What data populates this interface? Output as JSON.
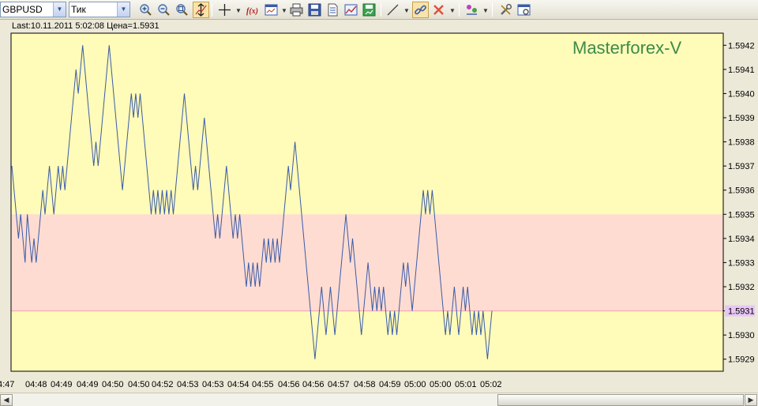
{
  "toolbar": {
    "symbol": "GBPUSD",
    "timeframe": "Тик",
    "fx_label": "f(x)"
  },
  "info_line": "Last:10.11.2011 5:02:08 Цена=1.5931",
  "watermark": "Masterforex-V",
  "chart_data": {
    "type": "line",
    "y_ticks": [
      "1.5942",
      "1.5941",
      "1.5940",
      "1.5939",
      "1.5938",
      "1.5937",
      "1.5936",
      "1.5935",
      "1.5934",
      "1.5933",
      "1.5932",
      "1.5931",
      "1.5930",
      "1.5929"
    ],
    "x_ticks": [
      "4:47",
      "04:48",
      "04:49",
      "04:49",
      "04:50",
      "04:50",
      "04:52",
      "04:53",
      "04:53",
      "04:54",
      "04:55",
      "04:56",
      "04:56",
      "04:57",
      "04:58",
      "04:59",
      "05:00",
      "05:00",
      "05:01",
      "05:02"
    ],
    "ylim": [
      1.59285,
      1.59425
    ],
    "current_price": "1.5931",
    "zone": [
      1.5931,
      1.5935
    ],
    "colors": {
      "line": "#3a5ba8",
      "background": "#fffbb8",
      "zone": "#ffdcd2",
      "price_label": "#e7c6f5"
    },
    "values": [
      1.5937,
      1.5936,
      1.5935,
      1.5934,
      1.5935,
      1.5934,
      1.5933,
      1.5935,
      1.5934,
      1.5933,
      1.5934,
      1.5933,
      1.5934,
      1.5935,
      1.5936,
      1.5935,
      1.5936,
      1.5937,
      1.5936,
      1.5935,
      1.5936,
      1.5937,
      1.5936,
      1.5937,
      1.5936,
      1.5937,
      1.5938,
      1.5939,
      1.594,
      1.5941,
      1.594,
      1.5941,
      1.5942,
      1.5941,
      1.594,
      1.5939,
      1.5938,
      1.5937,
      1.5938,
      1.5937,
      1.5938,
      1.5939,
      1.594,
      1.5941,
      1.5942,
      1.5941,
      1.594,
      1.5939,
      1.5938,
      1.5937,
      1.5936,
      1.5937,
      1.5938,
      1.5939,
      1.594,
      1.5939,
      1.594,
      1.5939,
      1.594,
      1.5939,
      1.5938,
      1.5937,
      1.5936,
      1.5935,
      1.5936,
      1.5935,
      1.5936,
      1.5935,
      1.5936,
      1.5935,
      1.5936,
      1.5935,
      1.5936,
      1.5935,
      1.5936,
      1.5937,
      1.5938,
      1.5939,
      1.594,
      1.5939,
      1.5938,
      1.5937,
      1.5936,
      1.5937,
      1.5936,
      1.5937,
      1.5938,
      1.5939,
      1.5938,
      1.5937,
      1.5936,
      1.5935,
      1.5934,
      1.5935,
      1.5934,
      1.5935,
      1.5936,
      1.5937,
      1.5936,
      1.5935,
      1.5934,
      1.5935,
      1.5934,
      1.5935,
      1.5934,
      1.5933,
      1.5932,
      1.5933,
      1.5932,
      1.5933,
      1.5932,
      1.5933,
      1.5932,
      1.5933,
      1.5934,
      1.5933,
      1.5934,
      1.5933,
      1.5934,
      1.5933,
      1.5934,
      1.5933,
      1.5934,
      1.5935,
      1.5936,
      1.5937,
      1.5936,
      1.5937,
      1.5938,
      1.5937,
      1.5936,
      1.5935,
      1.5934,
      1.5933,
      1.5932,
      1.5931,
      1.593,
      1.5929,
      1.593,
      1.5931,
      1.5932,
      1.5931,
      1.593,
      1.5931,
      1.5932,
      1.5931,
      1.593,
      1.5931,
      1.5932,
      1.5933,
      1.5934,
      1.5935,
      1.5934,
      1.5933,
      1.5934,
      1.5933,
      1.5932,
      1.5931,
      1.593,
      1.5931,
      1.5932,
      1.5933,
      1.5932,
      1.5931,
      1.5932,
      1.5931,
      1.5932,
      1.5931,
      1.5932,
      1.5931,
      1.593,
      1.5931,
      1.593,
      1.5931,
      1.593,
      1.5931,
      1.5932,
      1.5933,
      1.5932,
      1.5933,
      1.5932,
      1.5931,
      1.5932,
      1.5933,
      1.5934,
      1.5935,
      1.5936,
      1.5935,
      1.5936,
      1.5935,
      1.5936,
      1.5935,
      1.5934,
      1.5933,
      1.5932,
      1.5931,
      1.593,
      1.5931,
      1.593,
      1.5931,
      1.5932,
      1.5931,
      1.593,
      1.5931,
      1.5932,
      1.5931,
      1.5932,
      1.5931,
      1.593,
      1.5931,
      1.593,
      1.5931,
      1.593,
      1.5931,
      1.593,
      1.5929,
      1.593,
      1.5931
    ]
  }
}
